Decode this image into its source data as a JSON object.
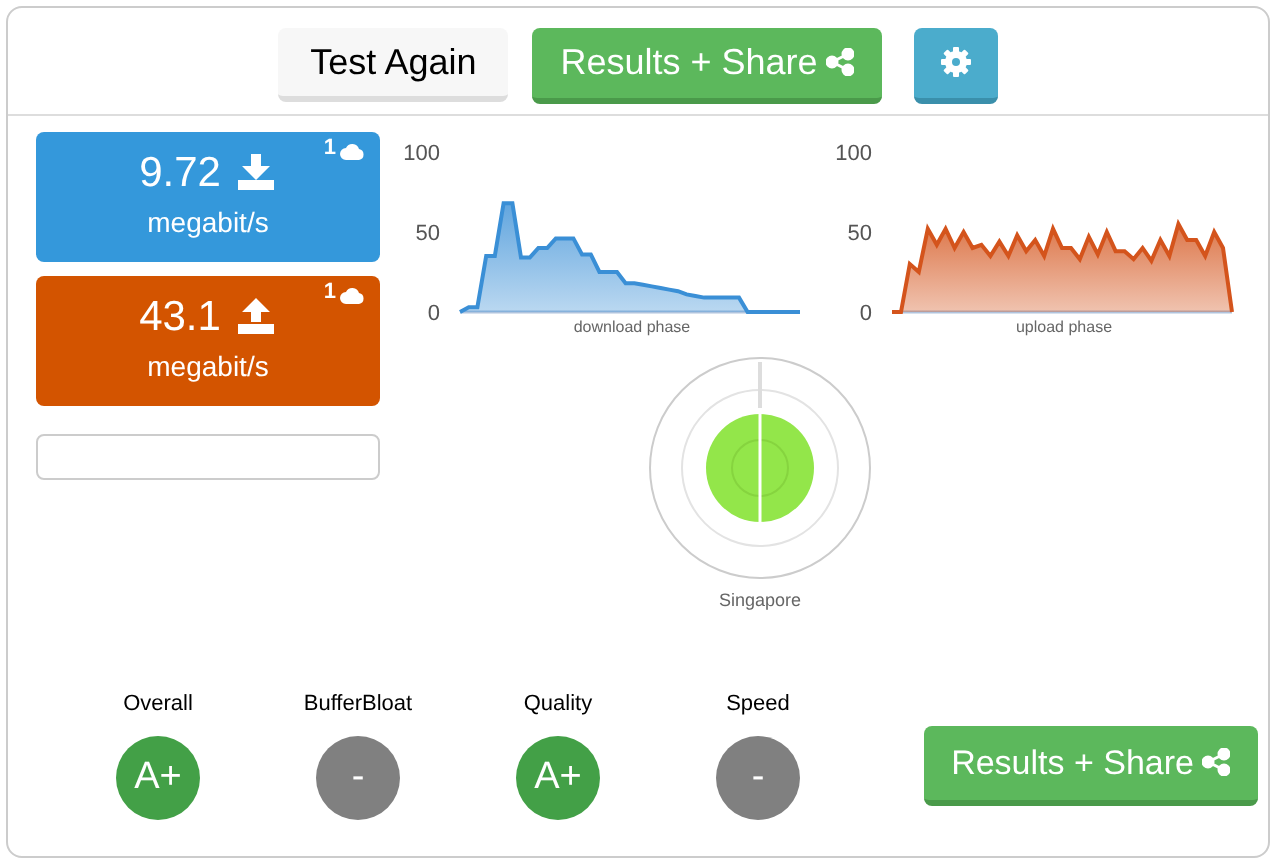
{
  "toolbar": {
    "test_again": "Test Again",
    "results_share": "Results + Share"
  },
  "speeds": [
    {
      "kind": "download",
      "value": "9.72",
      "unit": "megabit/s",
      "badge": "1"
    },
    {
      "kind": "upload",
      "value": "43.1",
      "unit": "megabit/s",
      "badge": "1"
    }
  ],
  "charts": [
    {
      "chart_data": {
        "type": "area",
        "xlabel": "download phase",
        "yticks": [
          0,
          50,
          100
        ],
        "ylim": [
          0,
          100
        ],
        "series": [
          {
            "color": "#3a8fd6",
            "values": [
              0,
              3,
              3,
              35,
              35,
              68,
              68,
              34,
              34,
              40,
              40,
              46,
              46,
              46,
              36,
              36,
              25,
              25,
              25,
              18,
              18,
              17,
              16,
              15,
              14,
              13,
              11,
              10,
              9,
              9,
              9,
              9,
              9,
              0,
              0,
              0,
              0,
              0,
              0,
              0
            ]
          }
        ]
      }
    },
    {
      "chart_data": {
        "type": "area",
        "xlabel": "upload phase",
        "yticks": [
          0,
          50,
          100
        ],
        "ylim": [
          0,
          100
        ],
        "series": [
          {
            "color": "#d4541c",
            "values": [
              0,
              0,
              30,
              25,
              52,
              42,
              52,
              40,
              50,
              40,
              42,
              35,
              44,
              35,
              48,
              38,
              45,
              35,
              52,
              40,
              40,
              33,
              47,
              36,
              50,
              38,
              38,
              33,
              40,
              32,
              45,
              35,
              55,
              45,
              45,
              35,
              50,
              40,
              0
            ]
          }
        ]
      }
    }
  ],
  "server": {
    "location": "Singapore"
  },
  "grades": [
    {
      "label": "Overall",
      "grade": "A+",
      "color": "#43a047"
    },
    {
      "label": "BufferBloat",
      "grade": "-",
      "color": "#808080"
    },
    {
      "label": "Quality",
      "grade": "A+",
      "color": "#43a047"
    },
    {
      "label": "Speed",
      "grade": "-",
      "color": "#808080"
    }
  ],
  "results_share": "Results + Share"
}
